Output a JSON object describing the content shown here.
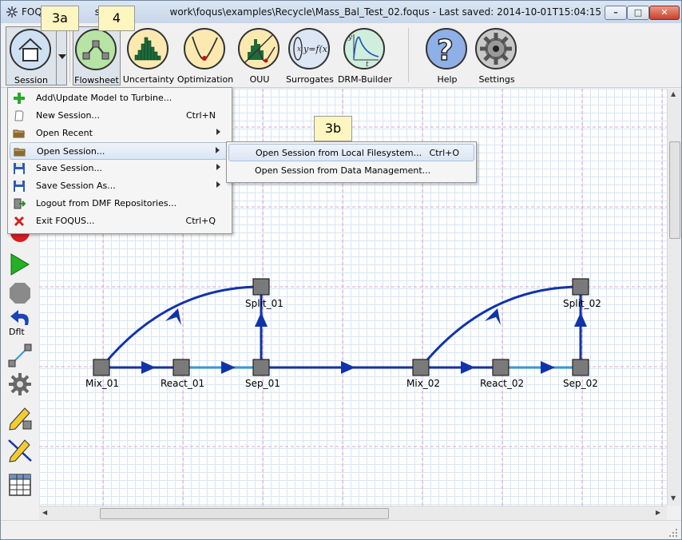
{
  "window": {
    "title": "FOQUS - C:\\Users\\...\\work\\foqus\\examples\\Recycle\\Mass_Bal_Test_02.foqus - Last saved: 2014-10-01T15:04:15",
    "title_visible": "FOQU               sers\\                 work\\foqus\\examples\\Recycle\\Mass_Bal_Test_02.foqus - Last saved: 2014-10-01T15:04:15",
    "minimize": "–",
    "maximize": "□",
    "close": "✕"
  },
  "toolbar": {
    "session": "Session",
    "flowsheet": "Flowsheet",
    "uncertainty": "Uncertainty",
    "optimization": "Optimization",
    "ouu": "OUU",
    "surrogates": "Surrogates",
    "surrogates_formula": "y=f(x)",
    "drm": "DRM-Builder",
    "help": "Help",
    "settings": "Settings"
  },
  "callouts": {
    "a": "3a",
    "b": "4",
    "c": "3b"
  },
  "menu": {
    "items": [
      {
        "label": "Add\\Update Model to Turbine...",
        "shortcut": "",
        "icon": "plus-icon"
      },
      {
        "label": "New Session...",
        "shortcut": "Ctrl+N",
        "icon": "new-document-icon"
      },
      {
        "label": "Open Recent",
        "shortcut": "",
        "icon": "folder-icon"
      },
      {
        "label": "Open Session...",
        "shortcut": "",
        "icon": "folder-icon"
      },
      {
        "label": "Save Session...",
        "shortcut": "",
        "icon": "floppy-icon"
      },
      {
        "label": "Save Session As...",
        "shortcut": "",
        "icon": "floppy-icon"
      },
      {
        "label": "Logout from DMF Repositories...",
        "shortcut": "",
        "icon": "logout-icon"
      },
      {
        "label": "Exit FOQUS...",
        "shortcut": "Ctrl+Q",
        "icon": "exit-icon"
      }
    ],
    "submenu": [
      {
        "label": "Open Session from Local Filesystem...",
        "shortcut": "Ctrl+O"
      },
      {
        "label": "Open Session from Data Management...",
        "shortcut": ""
      }
    ]
  },
  "left_tools": {
    "default_label": "Dflt"
  },
  "flowsheet": {
    "nodes": [
      "Mix_01",
      "React_01",
      "Sep_01",
      "Split_01",
      "Mix_02",
      "React_02",
      "Sep_02",
      "Split_02"
    ],
    "colors": {
      "edge": "#1133aa",
      "active_edge": "#3399dd",
      "node": "#7a7a7a",
      "grid": "#d8e6f4",
      "tear": "#dda0dd"
    }
  }
}
